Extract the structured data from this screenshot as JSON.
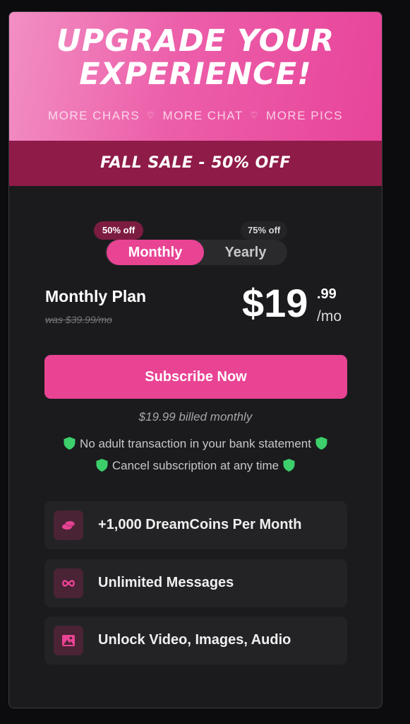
{
  "hero": {
    "title_line1": "UPGRADE YOUR",
    "title_line2": "EXPERIENCE!",
    "perks": [
      "MORE CHARS",
      "MORE CHAT",
      "MORE PICS"
    ],
    "gradient_colors": [
      "#f28fc4",
      "#e8449a"
    ]
  },
  "sale_banner": {
    "text": "FALL SALE - 50% OFF",
    "color": "#8f1b48"
  },
  "billing_toggle": {
    "options": [
      {
        "label": "Monthly",
        "badge": "50% off",
        "selected": true
      },
      {
        "label": "Yearly",
        "badge": "75% off",
        "selected": false
      }
    ]
  },
  "plan": {
    "name": "Monthly Plan",
    "was_price": "was $39.99/mo",
    "price_whole": "$19",
    "price_cents": ".99",
    "price_period": "/mo"
  },
  "subscribe_button": {
    "label": "Subscribe Now",
    "color": "#e94394"
  },
  "billing_note": "$19.99 billed monthly",
  "assurances": [
    "No adult transaction in your bank statement",
    "Cancel subscription at any time"
  ],
  "features": [
    {
      "icon": "coins-icon",
      "label": "+1,000 DreamCoins Per Month"
    },
    {
      "icon": "infinity-icon",
      "label": "Unlimited Messages"
    },
    {
      "icon": "image-icon",
      "label": "Unlock Video, Images, Audio"
    }
  ],
  "colors": {
    "accent": "#e94394",
    "background": "#1b1b1e",
    "shield": "#3ccf6b"
  }
}
